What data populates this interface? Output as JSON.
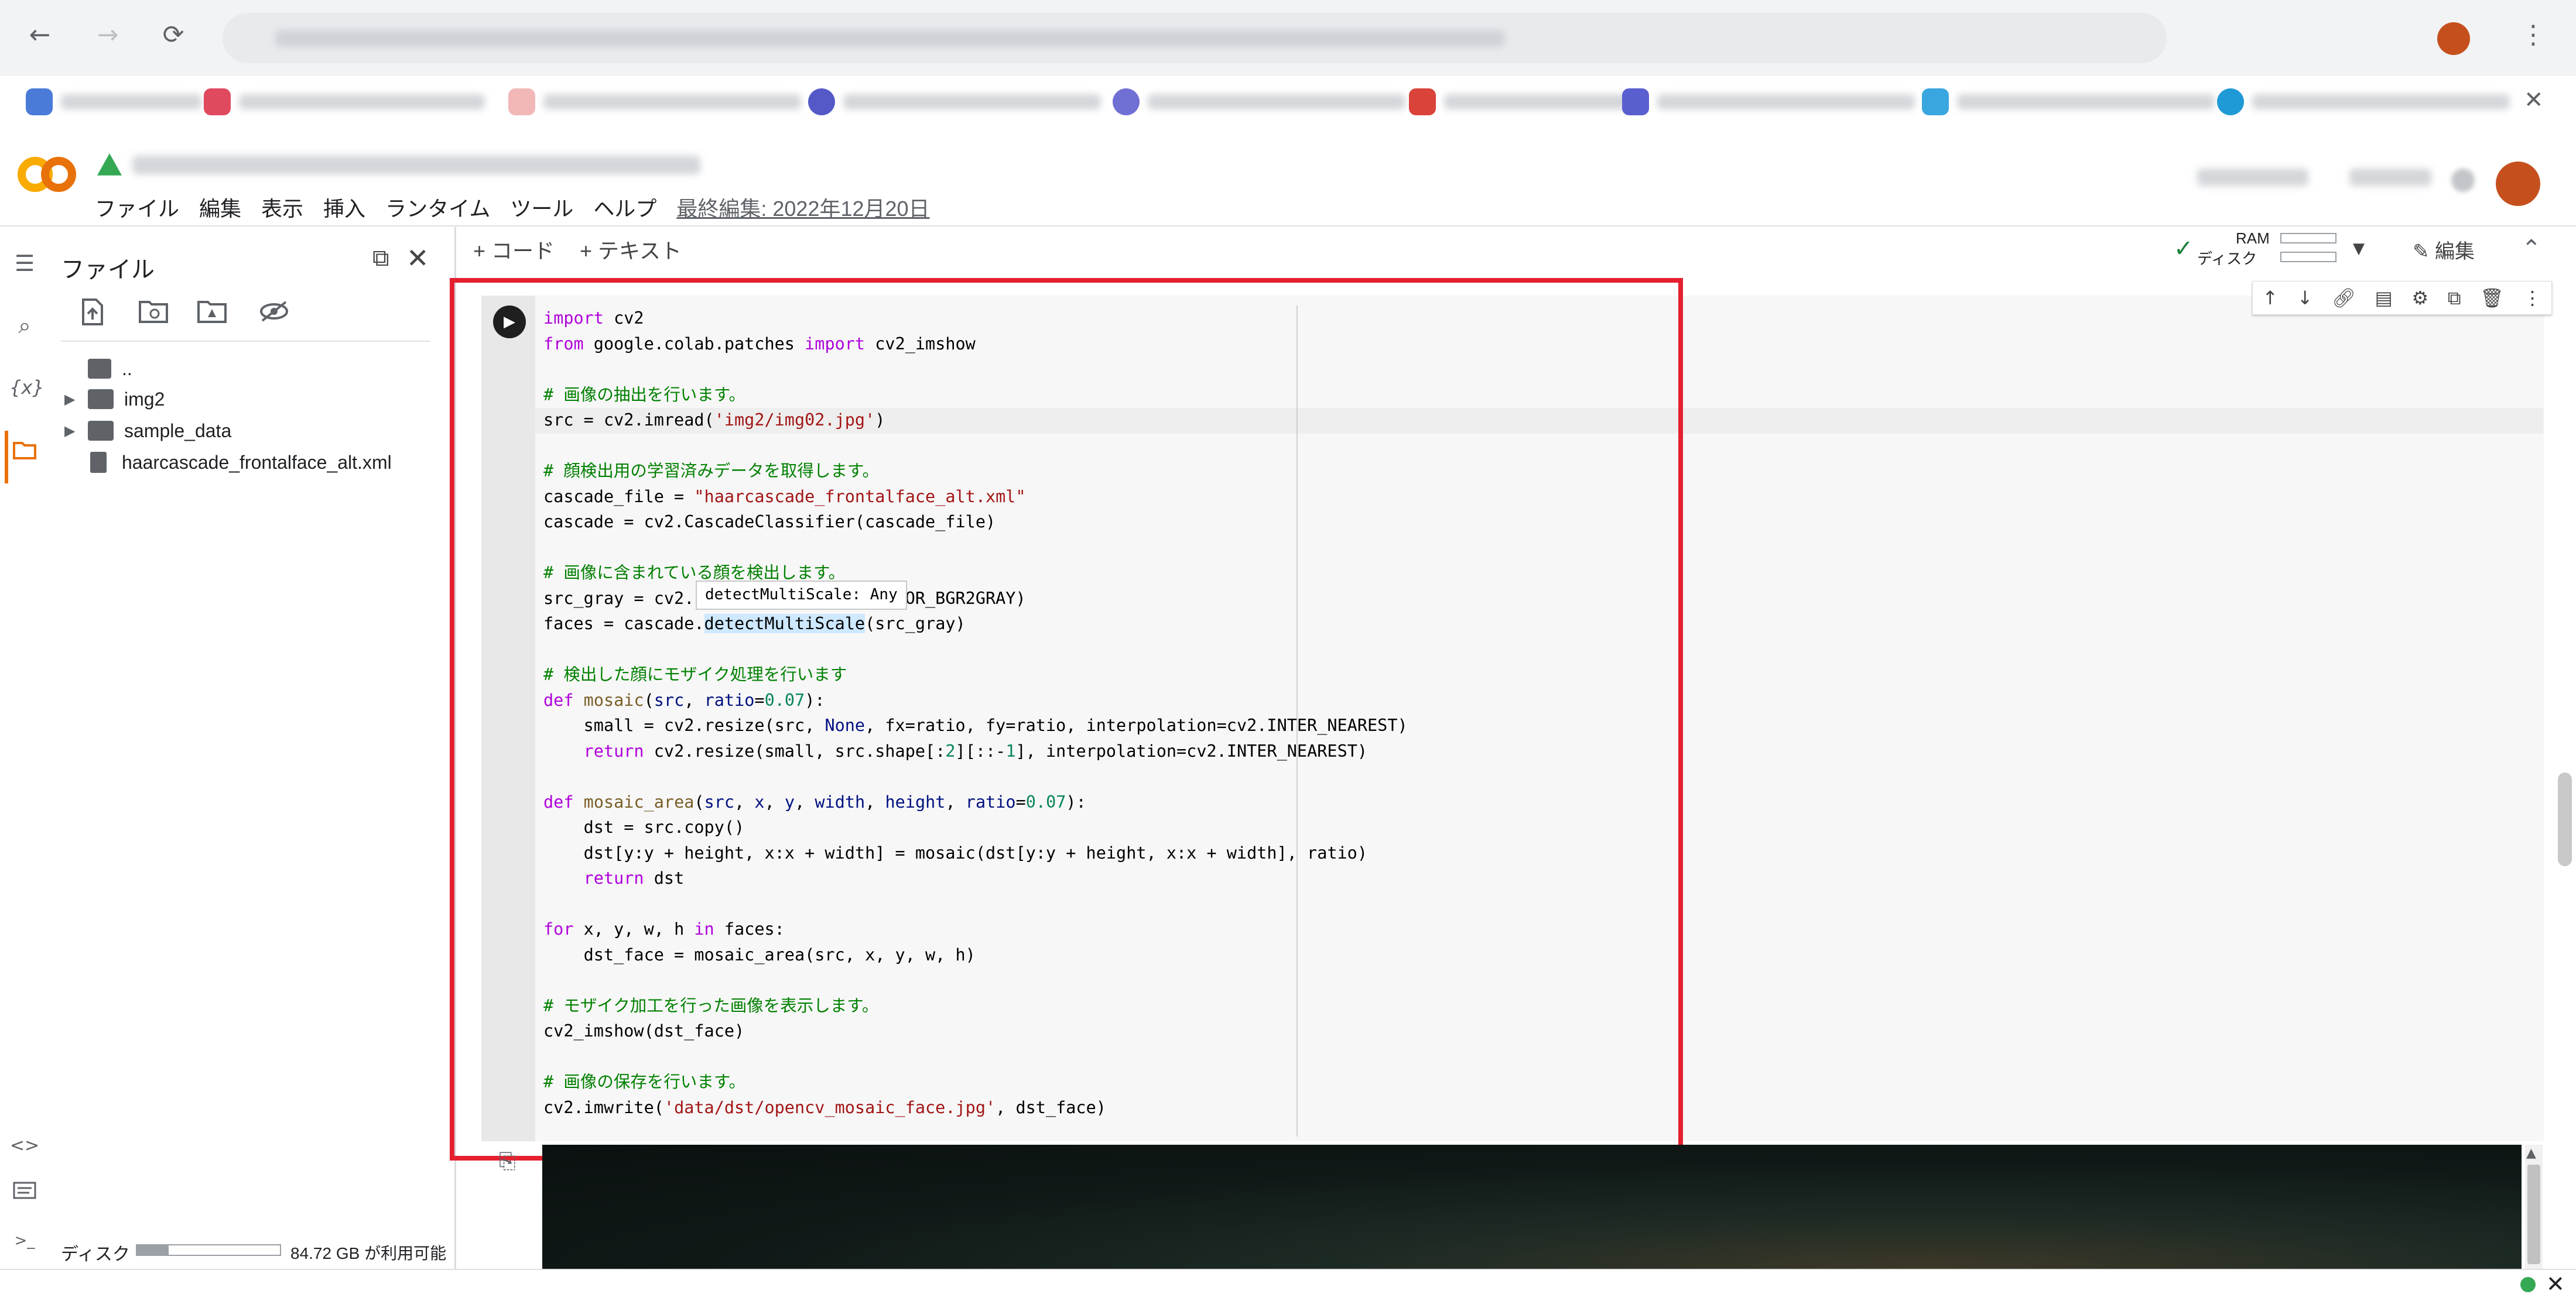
{
  "browser": {
    "nav_back": "←",
    "nav_forward": "→",
    "nav_reload": "⟳",
    "address_blurred": true
  },
  "bookmarks": {
    "count": 9,
    "close_icon": "✕"
  },
  "colab": {
    "notebook_title_blurred": true,
    "menu": [
      "ファイル",
      "編集",
      "表示",
      "挿入",
      "ランタイム",
      "ツール",
      "ヘルプ"
    ],
    "last_edited": "最終編集: 2022年12月20日"
  },
  "rail": {
    "icons": [
      "list-icon",
      "search-icon",
      "variables-icon",
      "folder-icon",
      "code-snippets-icon",
      "command-palette-icon",
      "terminal-icon"
    ],
    "variables_glyph": "{x}",
    "code_glyph": "<>",
    "terminal_glyph": ">_"
  },
  "file_panel": {
    "title": "ファイル",
    "tree": [
      {
        "name": "..",
        "type": "parent"
      },
      {
        "name": "img2",
        "type": "folder"
      },
      {
        "name": "sample_data",
        "type": "folder"
      },
      {
        "name": "haarcascade_frontalface_alt.xml",
        "type": "file"
      }
    ],
    "disk_label": "ディスク",
    "disk_free": "84.72 GB が利用可能",
    "disk_used_fraction": 0.2
  },
  "toolbar": {
    "add_code": "+ コード",
    "add_text": "+ テキスト",
    "ram_label": "RAM",
    "disk_label": "ディスク",
    "edit_label": "編集"
  },
  "cell": {
    "tooltip": "detectMultiScale: Any",
    "code_lines_count": 32
  },
  "colors": {
    "highlight_box": "#e5202f",
    "accent_orange": "#e8710a",
    "keyword": "#af00db",
    "comment": "#008000",
    "string": "#a31515",
    "number": "#098658"
  }
}
